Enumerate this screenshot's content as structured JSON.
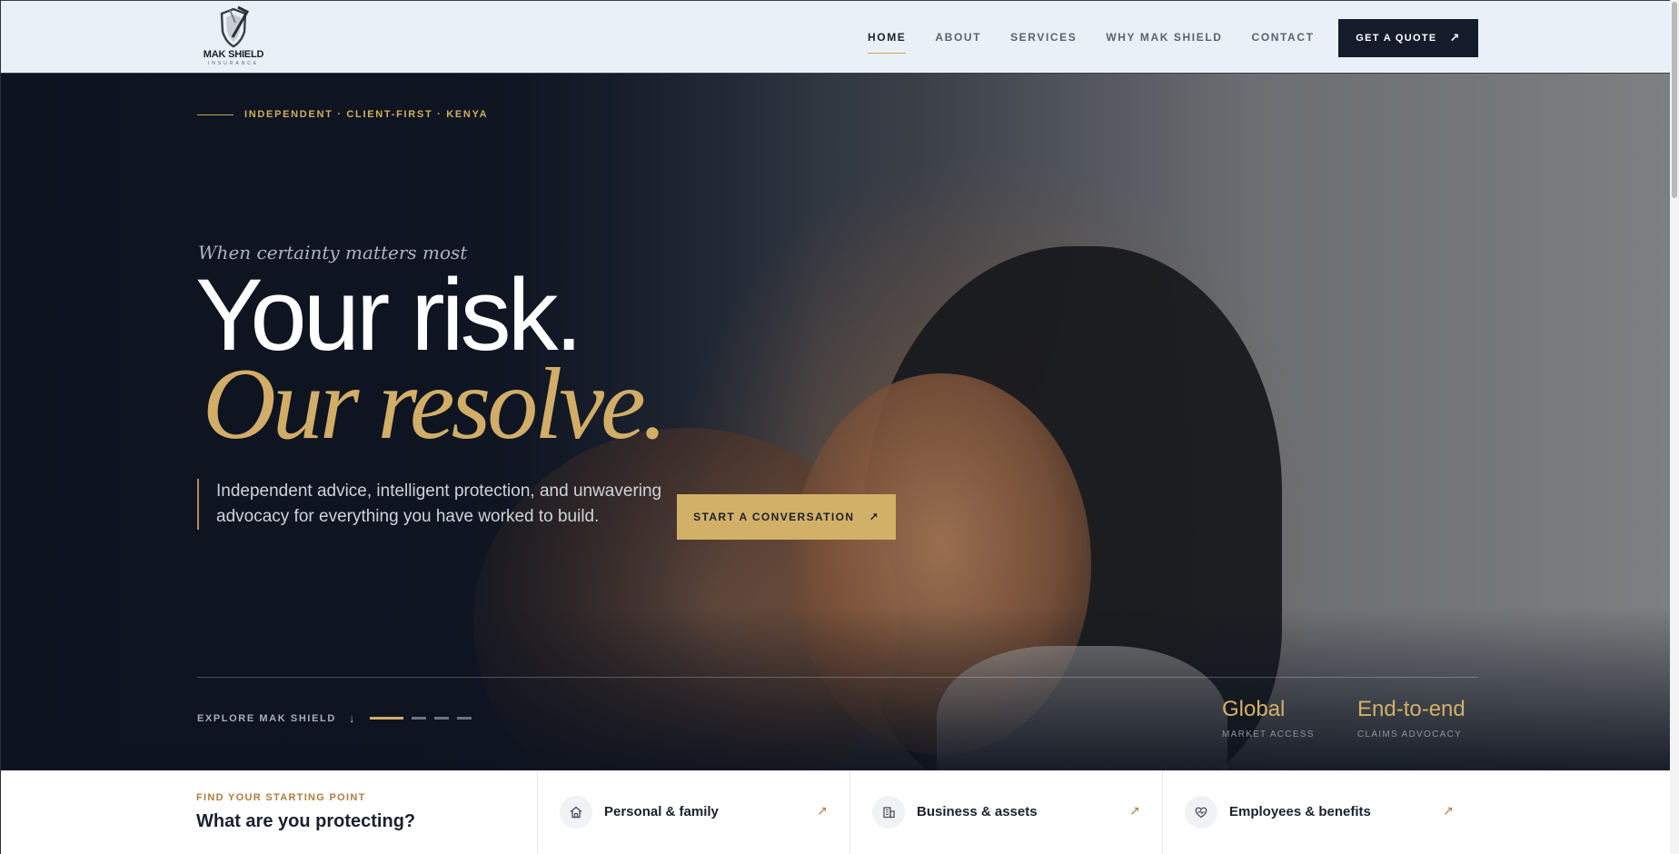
{
  "brand": {
    "name": "MAK SHIELD",
    "tagline": "INSURANCE"
  },
  "nav": {
    "items": [
      {
        "label": "HOME",
        "active": true
      },
      {
        "label": "ABOUT",
        "active": false
      },
      {
        "label": "SERVICES",
        "active": false
      },
      {
        "label": "WHY MAK SHIELD",
        "active": false
      },
      {
        "label": "CONTACT",
        "active": false
      }
    ],
    "quote_label": "GET A QUOTE",
    "quote_icon": "arrow-up-right-icon"
  },
  "hero": {
    "eyebrow": "INDEPENDENT · CLIENT-FIRST · KENYA",
    "kicker": "When certainty matters most",
    "title_line1": "Your risk.",
    "title_line2": "Our resolve.",
    "lead": "Independent advice, intelligent protection, and unwavering advocacy for everything you have worked to build.",
    "cta_label": "START A CONVERSATION",
    "explore_label": "EXPLORE MAK SHIELD",
    "slide_count": 4,
    "active_slide": 1,
    "stats": [
      {
        "value": "Global",
        "label": "MARKET ACCESS"
      },
      {
        "value": "End-to-end",
        "label": "CLAIMS ADVOCACY"
      }
    ]
  },
  "finder": {
    "eyebrow": "FIND YOUR STARTING POINT",
    "heading": "What are you protecting?",
    "cards": [
      {
        "label": "Personal & family",
        "icon": "home-icon"
      },
      {
        "label": "Business & assets",
        "icon": "building-icon"
      },
      {
        "label": "Employees & benefits",
        "icon": "heart-pulse-icon"
      }
    ]
  },
  "colors": {
    "accent": "#d3b067",
    "navy": "#141c2b",
    "header_bg": "#e9f0f8"
  }
}
